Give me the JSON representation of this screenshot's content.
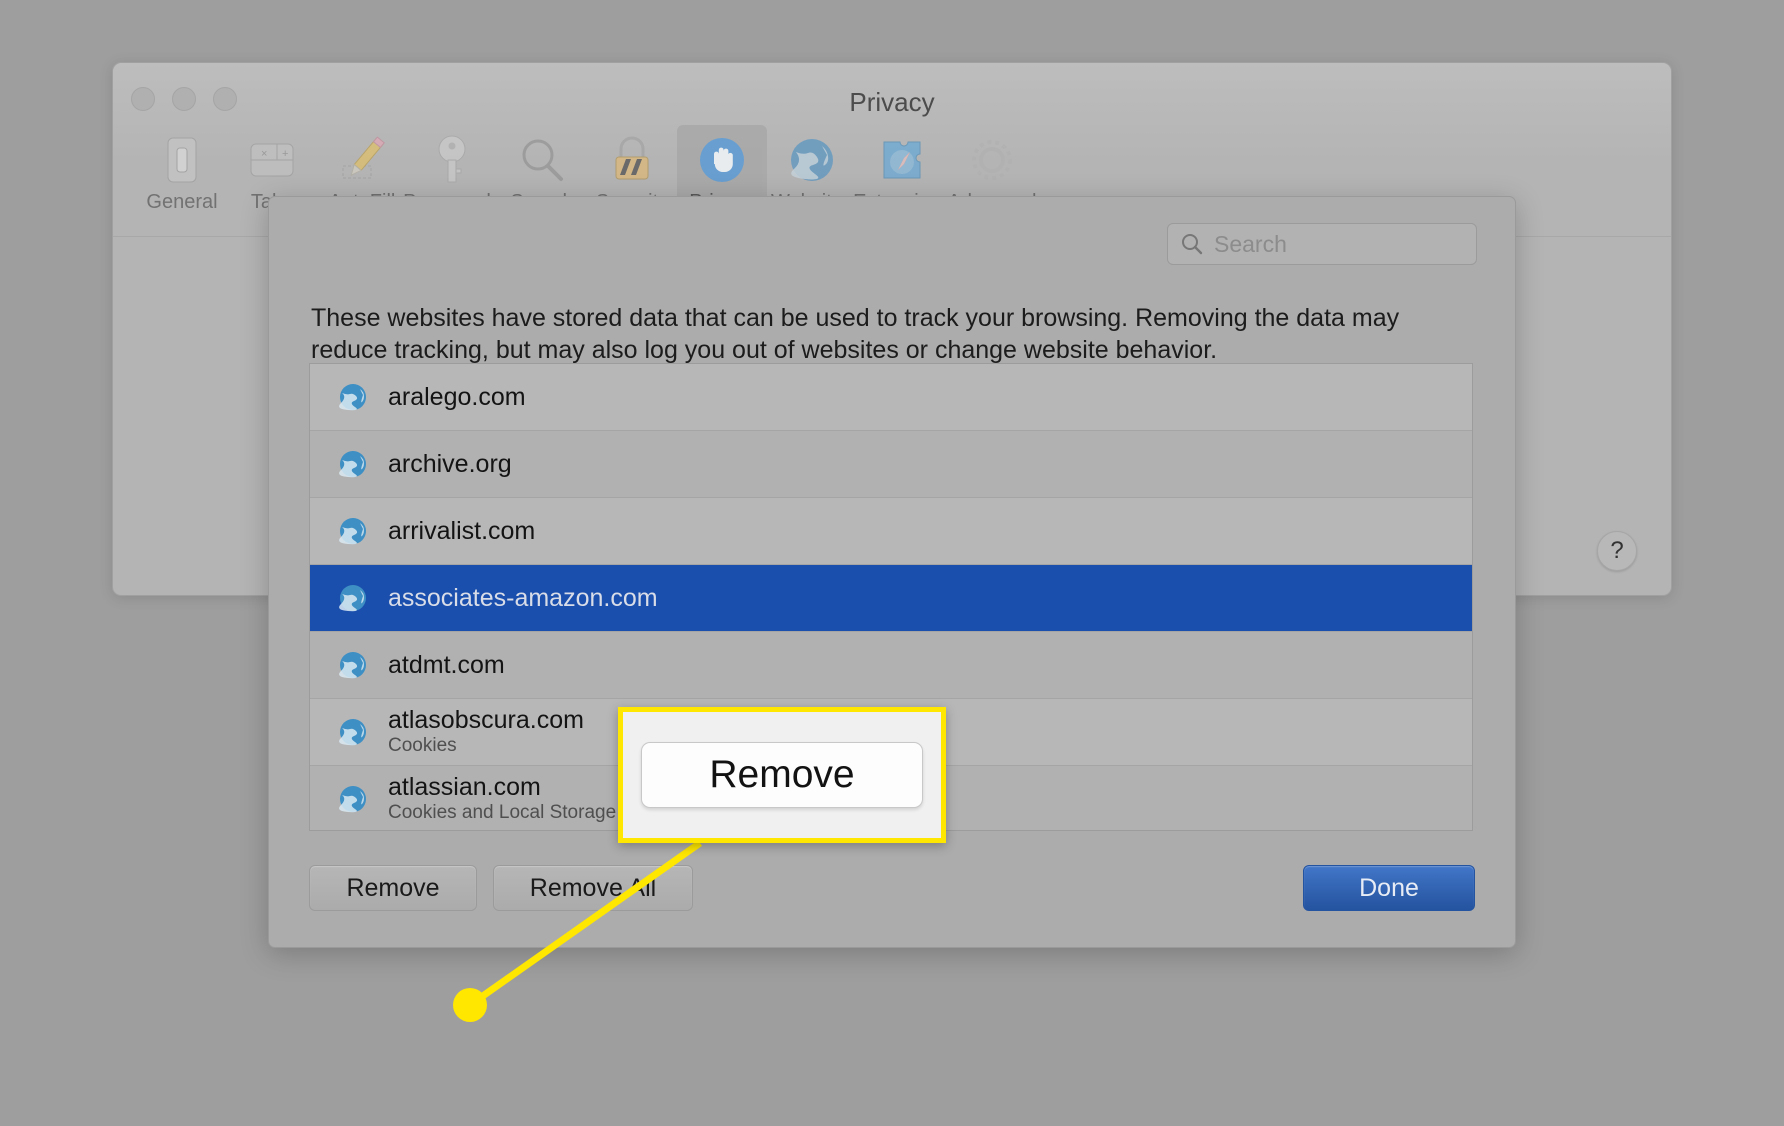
{
  "window": {
    "title": "Privacy",
    "traffic_lights": [
      "close-button",
      "minimize-button",
      "zoom-button"
    ],
    "help_label": "?"
  },
  "toolbar": {
    "items": [
      {
        "label": "General",
        "icon": "general-icon",
        "active": false
      },
      {
        "label": "Tabs",
        "icon": "tabs-icon",
        "active": false
      },
      {
        "label": "AutoFill",
        "icon": "autofill-icon",
        "active": false
      },
      {
        "label": "Passwords",
        "icon": "passwords-icon",
        "active": false
      },
      {
        "label": "Search",
        "icon": "search-icon",
        "active": false
      },
      {
        "label": "Security",
        "icon": "security-icon",
        "active": false
      },
      {
        "label": "Privacy",
        "icon": "privacy-icon",
        "active": true
      },
      {
        "label": "Websites",
        "icon": "websites-icon",
        "active": false
      },
      {
        "label": "Extensions",
        "icon": "extensions-icon",
        "active": false
      },
      {
        "label": "Advanced",
        "icon": "advanced-icon",
        "active": false
      }
    ]
  },
  "sheet": {
    "search": {
      "placeholder": "Search",
      "value": ""
    },
    "description": "These websites have stored data that can be used to track your browsing. Removing the data may reduce tracking, but may also log you out of websites or change website behavior.",
    "sites": [
      {
        "name": "aralego.com",
        "detail": "",
        "selected": false
      },
      {
        "name": "archive.org",
        "detail": "",
        "selected": false
      },
      {
        "name": "arrivalist.com",
        "detail": "",
        "selected": false
      },
      {
        "name": "associates-amazon.com",
        "detail": "",
        "selected": true
      },
      {
        "name": "atdmt.com",
        "detail": "",
        "selected": false
      },
      {
        "name": "atlasobscura.com",
        "detail": "Cookies",
        "selected": false
      },
      {
        "name": "atlassian.com",
        "detail": "Cookies and Local Storage",
        "selected": false
      }
    ],
    "buttons": {
      "remove": "Remove",
      "remove_all": "Remove All",
      "done": "Done"
    }
  },
  "callout": {
    "button_label": "Remove",
    "border_color": "#ffe700",
    "highlight_color": "#ffe700"
  },
  "colors": {
    "selection_blue": "#1b4fad",
    "done_blue": "#24539f",
    "desktop_gray": "#9e9e9e",
    "window_gray": "#b4b4b4",
    "sheet_gray": "#acacac"
  }
}
